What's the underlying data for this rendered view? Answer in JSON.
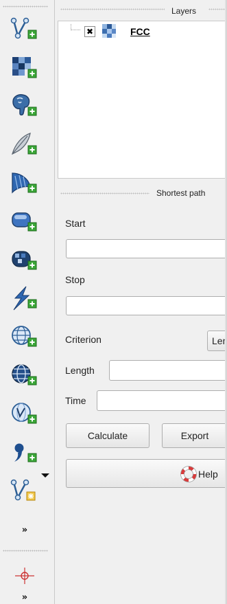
{
  "toolbar": {
    "tools": [
      {
        "icon": "add-vector-layer-icon"
      },
      {
        "icon": "add-raster-layer-icon"
      },
      {
        "icon": "add-postgis-layer-icon"
      },
      {
        "icon": "add-spatialite-layer-icon"
      },
      {
        "icon": "add-mssql-layer-icon"
      },
      {
        "icon": "add-oracle-layer-icon"
      },
      {
        "icon": "add-db2-layer-icon"
      },
      {
        "icon": "add-wms-layer-icon"
      },
      {
        "icon": "add-wcs-layer-icon"
      },
      {
        "icon": "add-wfs-layer-icon"
      },
      {
        "icon": "add-delimited-text-layer-icon"
      },
      {
        "icon": "new-layer-icon"
      }
    ]
  },
  "layers_panel": {
    "title": "Layers",
    "layers": [
      {
        "name": "FCC",
        "visible_mark": "✖"
      }
    ]
  },
  "shortest_path": {
    "title": "Shortest path",
    "start_label": "Start",
    "start_value": "",
    "stop_label": "Stop",
    "stop_value": "",
    "criterion_label": "Criterion",
    "criterion_value": "Len",
    "length_label": "Length",
    "length_value": "",
    "time_label": "Time",
    "time_value": "",
    "calculate_label": "Calculate",
    "export_label": "Export",
    "help_label": "Help"
  },
  "colors": {
    "background": "#f0f0f0",
    "icon_blue": "#1f5fa8",
    "add_green": "#3aa637"
  }
}
